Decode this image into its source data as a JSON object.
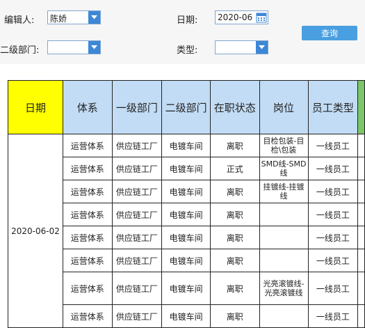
{
  "filters": {
    "editor_label": "编辑人:",
    "editor_value": "陈娇",
    "date_label": "日期:",
    "date_value": "2020-06",
    "dept2_label": "二级部门:",
    "dept2_value": "",
    "type_label": "类型:",
    "type_value": "",
    "query_label": "查询"
  },
  "table": {
    "headers": {
      "date": "日期",
      "system": "体系",
      "dept1": "一级部门",
      "dept2": "二级部门",
      "status": "在职状态",
      "post": "岗位",
      "emp_type": "员工类型"
    },
    "date_value": "2020-06-02",
    "rows": [
      {
        "system": "运营体系",
        "dept1": "供应链工厂",
        "dept2": "电镀车间",
        "status": "离职",
        "post": "目检包装-目检\\包装",
        "emp_type": "一线员工"
      },
      {
        "system": "运营体系",
        "dept1": "供应链工厂",
        "dept2": "电镀车间",
        "status": "正式",
        "post": "SMD线-SMD线",
        "emp_type": "一线员工"
      },
      {
        "system": "运营体系",
        "dept1": "供应链工厂",
        "dept2": "电镀车间",
        "status": "离职",
        "post": "挂镀线-挂镀线",
        "emp_type": "一线员工"
      },
      {
        "system": "运营体系",
        "dept1": "供应链工厂",
        "dept2": "电镀车间",
        "status": "离职",
        "post": "",
        "emp_type": "一线员工"
      },
      {
        "system": "运营体系",
        "dept1": "供应链工厂",
        "dept2": "电镀车间",
        "status": "离职",
        "post": "",
        "emp_type": "一线员工"
      },
      {
        "system": "运营体系",
        "dept1": "供应链工厂",
        "dept2": "电镀车间",
        "status": "离职",
        "post": "",
        "emp_type": "一线员工"
      },
      {
        "system": "运营体系",
        "dept1": "供应链工厂",
        "dept2": "电镀车间",
        "status": "离职",
        "post": "光亮滚镀线-光亮滚镀线",
        "emp_type": "一线员工"
      },
      {
        "system": "运营体系",
        "dept1": "供应链工厂",
        "dept2": "电镀车间",
        "status": "离职",
        "post": "",
        "emp_type": "一线员工"
      }
    ]
  }
}
